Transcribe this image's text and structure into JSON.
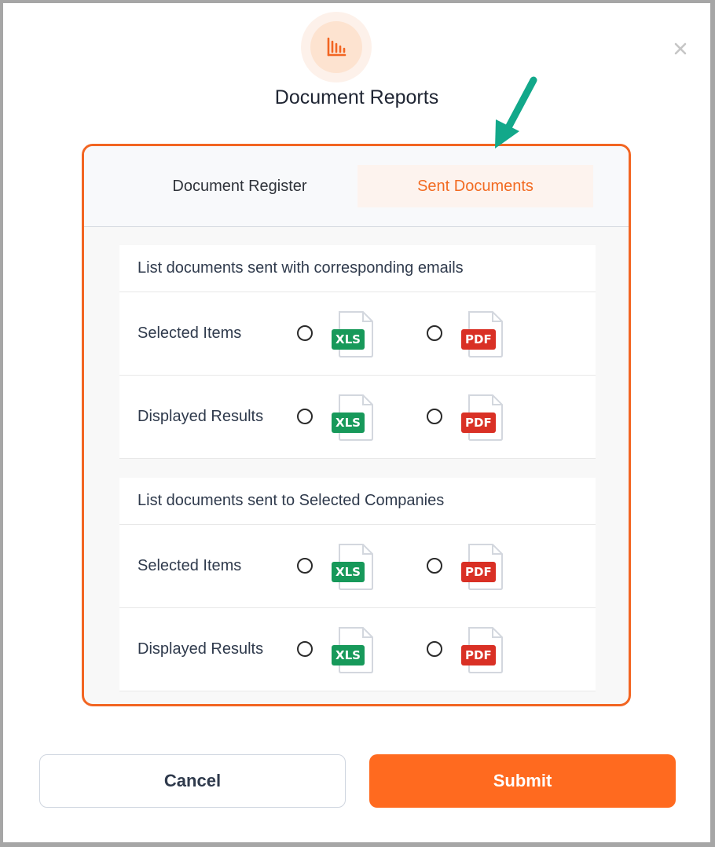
{
  "dialog": {
    "title": "Document Reports",
    "header_icon": "bar-chart-icon",
    "close_icon": "close-icon"
  },
  "annotation": {
    "icon": "arrow-pointer-icon",
    "color": "#12a88a"
  },
  "tabs": [
    {
      "label": "Document Register",
      "active": false
    },
    {
      "label": "Sent Documents",
      "active": true
    }
  ],
  "sections": [
    {
      "title": "List documents sent with corresponding emails",
      "rows": [
        {
          "label": "Selected Items",
          "xls_badge": "XLS",
          "pdf_badge": "PDF",
          "xls_selected": false,
          "pdf_selected": false
        },
        {
          "label": "Displayed Results",
          "xls_badge": "XLS",
          "pdf_badge": "PDF",
          "xls_selected": false,
          "pdf_selected": false
        }
      ]
    },
    {
      "title": "List documents sent to Selected Companies",
      "rows": [
        {
          "label": "Selected Items",
          "xls_badge": "XLS",
          "pdf_badge": "PDF",
          "xls_selected": false,
          "pdf_selected": false
        },
        {
          "label": "Displayed Results",
          "xls_badge": "XLS",
          "pdf_badge": "PDF",
          "xls_selected": false,
          "pdf_selected": false
        }
      ]
    }
  ],
  "buttons": {
    "cancel": "Cancel",
    "submit": "Submit"
  },
  "colors": {
    "accent": "#f26522",
    "submit": "#ff6a1f",
    "xls": "#17995a",
    "pdf": "#d93025"
  }
}
